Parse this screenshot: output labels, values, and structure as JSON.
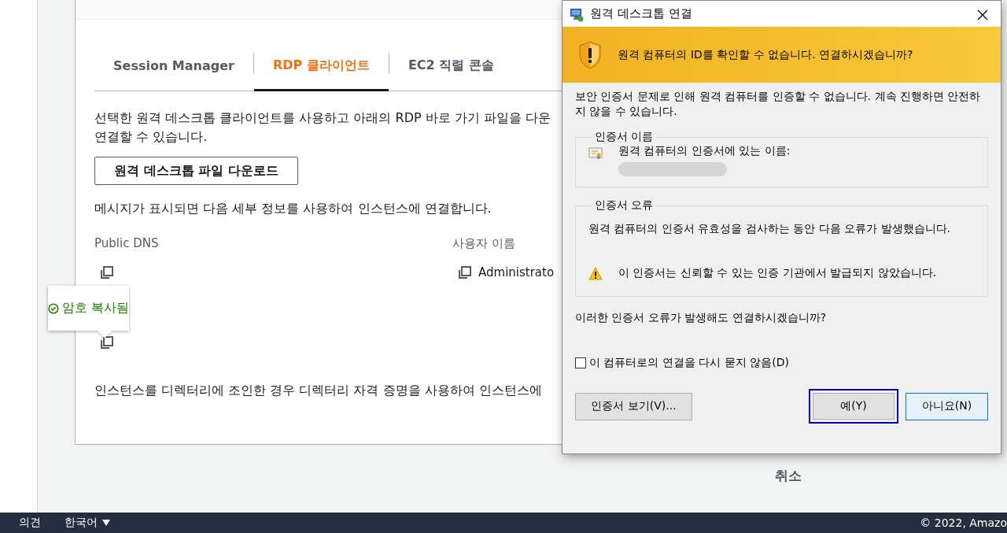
{
  "tabs": [
    {
      "label": "Session Manager",
      "selected": false
    },
    {
      "label": "RDP 클라이언트",
      "selected": true
    },
    {
      "label": "EC2 직렬 콘솔",
      "selected": false
    }
  ],
  "intro_lines": [
    "선택한 원격 데스크톱 클라이언트를 사용하고 아래의 RDP 바로 가기 파일을 다운",
    "연결할 수 있습니다."
  ],
  "download_button": "원격 데스크톱 파일 다운로드",
  "prompt_text": "메시지가 표시되면 다음 세부 정보를 사용하여 인스턴스에 연결합니다.",
  "fields": [
    {
      "label": "Public DNS"
    },
    {
      "label": "사용자 이름",
      "value": "Administrato"
    }
  ],
  "tooltip": {
    "text": "암호 복사됨"
  },
  "directory_note": "인스턴스를 디렉터리에 조인한 경우 디렉터리 자격 증명을 사용하여 인스턴스에",
  "cancel_button": "취소",
  "footer": {
    "links": [
      "의견",
      "한국어"
    ],
    "copyright": "© 2022, Amazo"
  },
  "dialog": {
    "title": "원격 데스크톱 연결",
    "banner": "원격 컴퓨터의 ID를 확인할 수 없습니다. 연결하시겠습니까?",
    "description": "보안 인증서 문제로 인해 원격 컴퓨터를 인증할 수 없습니다. 계속 진행하면 안전하지 않을 수 있습니다.",
    "name_group": {
      "title": "인증서 이름",
      "label": "원격 컴퓨터의 인증서에 있는 이름:"
    },
    "error_group": {
      "title": "인증서 오류",
      "text": "원격 컴퓨터의 인증서 유효성을 검사하는 동안 다음 오류가 발생했습니다.",
      "warning": "이 인증서는 신뢰할 수 있는 인증 기관에서 발급되지 않았습니다."
    },
    "question": "이러한 인증서 오류가 발생해도 연결하시겠습니까?",
    "checkbox": {
      "label": "이 컴퓨터로의 연결을 다시 묻지 않음(D)",
      "checked": false
    },
    "buttons": [
      {
        "label": "인증서 보기(V)...",
        "selected": false,
        "hovered": false
      },
      {
        "label": "예(Y)",
        "selected": true,
        "hovered": false
      },
      {
        "label": "아니요(N)",
        "selected": false,
        "hovered": true
      }
    ]
  }
}
